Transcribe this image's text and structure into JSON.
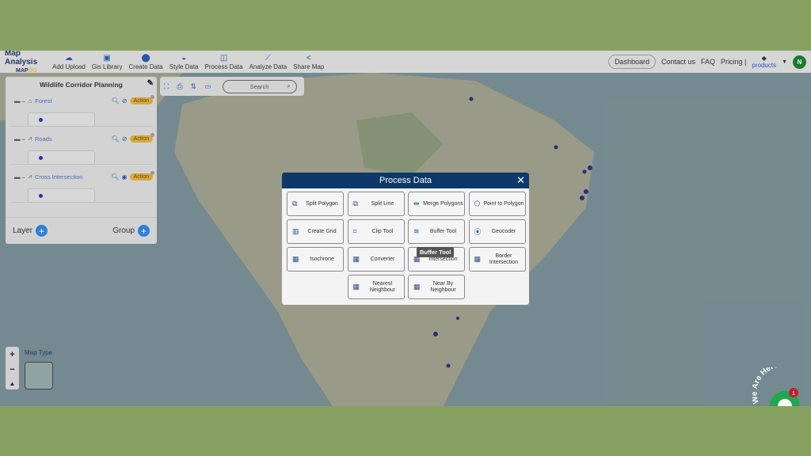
{
  "header": {
    "logo_title": "Map Analysis",
    "logo_sub": "MAP",
    "logo_sub_accent": "OG",
    "nav": [
      {
        "label": "Add Upload",
        "icon": "cloud-upload-icon"
      },
      {
        "label": "Gis Library",
        "icon": "library-icon"
      },
      {
        "label": "Create Data",
        "icon": "map-pin-icon"
      },
      {
        "label": "Style Data",
        "icon": "paint-bucket-icon"
      },
      {
        "label": "Process Data",
        "icon": "process-icon"
      },
      {
        "label": "Analyze Data",
        "icon": "analyze-icon"
      },
      {
        "label": "Share Map",
        "icon": "share-icon"
      }
    ],
    "dashboard": "Dashboard",
    "contact": "Contact us",
    "faq": "FAQ",
    "pricing": "Pricing |",
    "products": "products",
    "avatar": "N"
  },
  "panel": {
    "title": "Wildlife Corridor Planning",
    "layers": [
      {
        "name": "Forest",
        "visible": false,
        "action": "Action"
      },
      {
        "name": "Roads",
        "visible": false,
        "action": "Action"
      },
      {
        "name": "Cross Intersection",
        "visible": true,
        "action": "Action"
      }
    ],
    "layer_label": "Layer",
    "group_label": "Group"
  },
  "toolbar": {
    "search_placeholder": "Search"
  },
  "map": {
    "map_type": "Map Type"
  },
  "modal": {
    "title": "Process Data",
    "tools": [
      {
        "label": "Split Polygon"
      },
      {
        "label": "Split Line"
      },
      {
        "label": "Merge Polygons"
      },
      {
        "label": "Point to Polygon"
      },
      {
        "label": "Create Grid"
      },
      {
        "label": "Clip Tool"
      },
      {
        "label": "Buffer Tool"
      },
      {
        "label": "Geocoder"
      },
      {
        "label": "Isochrone"
      },
      {
        "label": "Converter"
      },
      {
        "label": "Intersection"
      },
      {
        "label": "Border Intersection"
      },
      {
        "label": "Nearest Neighbour"
      },
      {
        "label": "Near By Neighbour"
      }
    ],
    "tooltip": "Buffer Tool"
  },
  "chat": {
    "text": "We Are Here!",
    "badge": "1"
  },
  "colors": {
    "border": "#87a160",
    "modal_header": "#0d3867",
    "accent": "#2f7fd8",
    "action": "#d9a93a"
  }
}
